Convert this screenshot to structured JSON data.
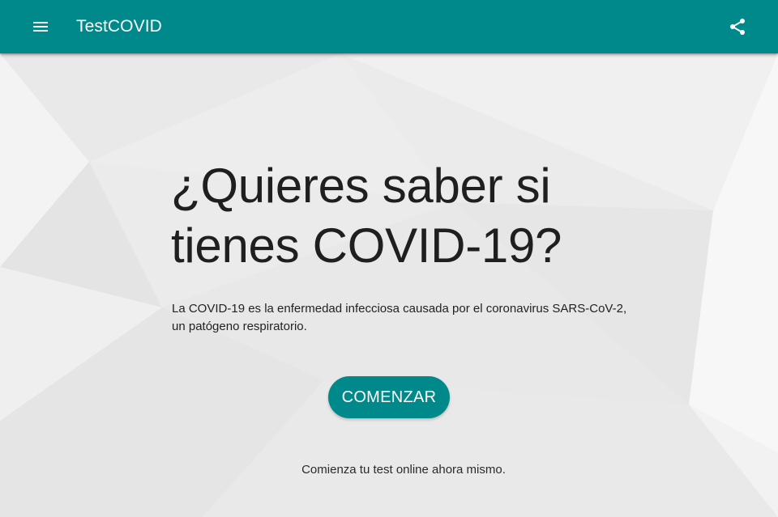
{
  "colors": {
    "accent": "#00898a"
  },
  "appbar": {
    "title": "TestCOVID",
    "menu_icon": "menu-icon",
    "share_icon": "share-icon"
  },
  "hero": {
    "headline": "¿Quieres saber si tienes COVID-19?",
    "description": "La COVID-19 es la enfermedad infecciosa causada por el coronavirus SARS-CoV-2, un patógeno respiratorio.",
    "cta_label": "COMENZAR",
    "subtext": "Comienza tu test online ahora mismo."
  }
}
